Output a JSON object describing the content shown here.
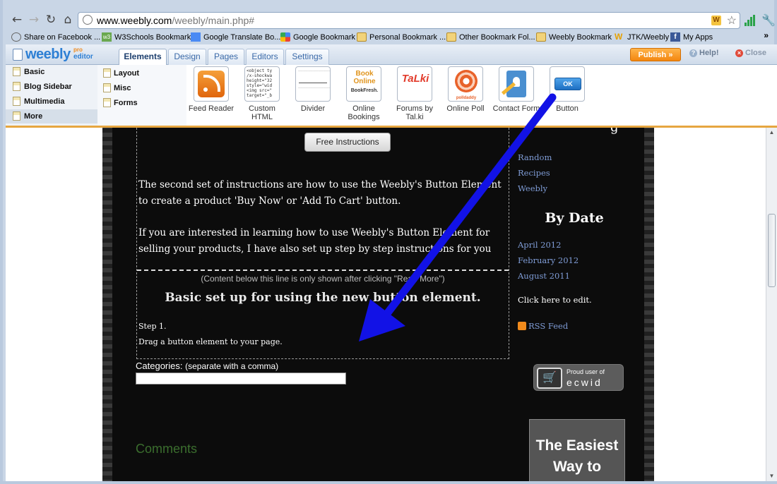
{
  "browser": {
    "url_host": "www.weebly.com",
    "url_path": "/weebly/main.php#",
    "bookmarks": [
      {
        "label": "Share on Facebook ...",
        "icon": "share-icon"
      },
      {
        "label": "W3Schools Bookmark",
        "icon": "w3schools-icon"
      },
      {
        "label": "Google Translate Bo...",
        "icon": "google-translate-icon"
      },
      {
        "label": "Google Bookmark",
        "icon": "google-icon"
      },
      {
        "label": "Personal Bookmark ...",
        "icon": "folder-icon"
      },
      {
        "label": "Other Bookmark Fol...",
        "icon": "folder-icon"
      },
      {
        "label": "Weebly Bookmark",
        "icon": "folder-icon"
      },
      {
        "label": "JTK/Weebly",
        "icon": "jtk-icon"
      },
      {
        "label": "My Apps",
        "icon": "facebook-icon"
      }
    ],
    "bookmarks_more": "»"
  },
  "editor": {
    "logo": {
      "name": "weebly",
      "pro": "pro",
      "edition": "editor"
    },
    "tabs": [
      {
        "label": "Elements",
        "active": true
      },
      {
        "label": "Design",
        "active": false
      },
      {
        "label": "Pages",
        "active": false
      },
      {
        "label": "Editors",
        "active": false
      },
      {
        "label": "Settings",
        "active": false
      }
    ],
    "publish_label": "Publish »",
    "help_label": "Help!",
    "close_label": "Close",
    "categories": [
      {
        "label": "Basic",
        "selected": false
      },
      {
        "label": "Blog Sidebar",
        "selected": false
      },
      {
        "label": "Multimedia",
        "selected": false
      },
      {
        "label": "More",
        "selected": true
      }
    ],
    "subcategories": [
      {
        "label": "Layout"
      },
      {
        "label": "Misc"
      },
      {
        "label": "Forms"
      }
    ],
    "elements": [
      {
        "label": "Feed Reader",
        "icon": "rss-feed-icon"
      },
      {
        "label": "Custom HTML",
        "icon": "custom-html-icon",
        "code": "<object ty\n/x-shockwa\nheight=\"32\nstyle=\"wid\n<img src=\"\ntarget=\"_b"
      },
      {
        "label": "Divider",
        "icon": "divider-icon"
      },
      {
        "label": "Online Bookings",
        "icon": "bookfresh-icon",
        "brand_top": "Book Online",
        "brand_bottom": "BookFresh."
      },
      {
        "label": "Forums by Tal.ki",
        "icon": "talki-icon",
        "brand": "TaLki"
      },
      {
        "label": "Online Poll",
        "icon": "polldaddy-icon",
        "brand": "polldaddy"
      },
      {
        "label": "Contact Form",
        "icon": "contact-form-icon"
      },
      {
        "label": "Button",
        "icon": "button-element-icon",
        "brand": "OK"
      }
    ]
  },
  "page": {
    "free_instructions_btn": "Free Instructions",
    "para1": "The second set of instructions are how to use the  Weebly's Button Element  to create a product 'Buy Now' or 'Add To Cart' button.",
    "para2": "If you are interested in learning how to use Weebly's Button Element for selling your products, I have also set up step by step instructions for you",
    "readmore_note": "(Content below this line is only shown after clicking \"Read More\")",
    "heading": "Basic set up for using the new button element.",
    "step1": "Step 1.",
    "step1_text": "Drag a button element to your page.",
    "categories_label": "Categories:",
    "categories_hint": "(separate with a comma)",
    "comments": "Comments",
    "sidebar": {
      "categories": [
        "Random",
        "Recipes",
        "Weebly"
      ],
      "by_date_heading": "By Date",
      "dates": [
        "April 2012",
        "February 2012",
        "August 2011"
      ],
      "click_edit": "Click here to edit.",
      "rss": "RSS Feed",
      "ecwid_top": "Proud user of",
      "ecwid_brand": "ecwid",
      "ad_text": "The Easiest Way to"
    }
  },
  "colors": {
    "arrow": "#1212e6",
    "publish": "#f3860f",
    "link": "#7f9cd6"
  }
}
